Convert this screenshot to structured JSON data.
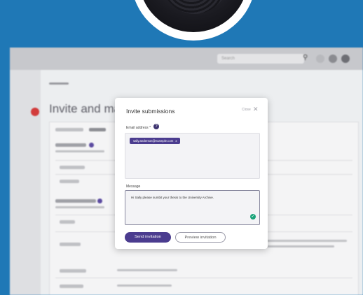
{
  "page": {
    "brand_blue": "#1f78b6"
  },
  "app": {
    "search_placeholder": "Search",
    "sidebar_label": "",
    "breadcrumb_top": "",
    "breadcrumb_nav": "",
    "page_title": "Invite and mana"
  },
  "modal": {
    "title": "Invite submissions",
    "close_label": "Close",
    "email_label": "Email address",
    "required_mark": "*",
    "email_chips": [
      "sally.anderson@example.com"
    ],
    "chip_remove": "x",
    "message_label": "Message",
    "message_value": "Hi Sally please sumbit your thesis to the University Archive.",
    "send_label": "Send invitation",
    "preview_label": "Preview invitation"
  },
  "colors": {
    "primary_purple": "#4b3c8f",
    "notification_red": "#d23b3b",
    "grammar_green": "#1aa37a"
  }
}
